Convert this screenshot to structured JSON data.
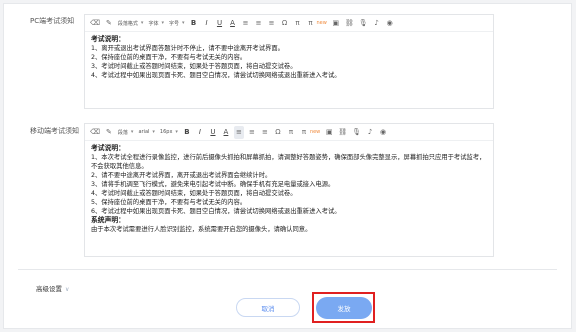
{
  "pc_section": {
    "label": "PC端考试须知",
    "toolbar": [
      "段落格式",
      "字体",
      "字号"
    ],
    "lines": [
      {
        "text": "考试说明：",
        "bold": true
      },
      {
        "text": "1、离开或退出考试界面答题计时不停止，请不要中途离开考试界面。"
      },
      {
        "text": "2、保持座位前的桌面干净，不要有与考试无关的内容。"
      },
      {
        "text": "3、考试时间截止或答题时间结束，如果处于答题页面，将自动提交试卷。"
      },
      {
        "text": "4、考试过程中如果出现页面卡死、题目空白情况，请尝试切换网络或退出重新进入考试。"
      }
    ]
  },
  "mobile_section": {
    "label": "移动端考试须知",
    "toolbar": [
      "段落",
      "arial",
      "16px"
    ],
    "lines": [
      {
        "text": "考试说明：",
        "bold": true
      },
      {
        "text": "1、本次考试全程进行录像监控，进行前后摄像头抓拍和屏幕抓拍，请调整好答题姿势，确保面部头像完整显示，屏幕抓拍只应用于考试监考，不会获取其他信息。"
      },
      {
        "text": "2、请不要中途离开考试界面，离开或退出考试界面会继续计时。"
      },
      {
        "text": "3、请将手机调至飞行模式，避免来电引起考试中断。确保手机有充足电量或接入电源。"
      },
      {
        "text": "4、考试时间截止或答题时间结束，如果处于答题页面，将自动提交试卷。"
      },
      {
        "text": "5、保持座位前的桌面干净，不要有与考试无关的内容。"
      },
      {
        "text": "6、考试过程中如果出现页面卡死、题目空白情况，请尝试切换网络或退出重新进入考试。"
      },
      {
        "text": "系统声明：",
        "bold": true
      },
      {
        "text": "由于本次考试需要进行人脸识别监控，系统需要开启您的摄像头，请确认同意。"
      }
    ]
  },
  "toolbar_icons": {
    "eraser": "⌫",
    "brush": "✎",
    "bold": "B",
    "italic": "I",
    "underline": "U",
    "font_color": "A",
    "align_left": "≡",
    "align_center": "≡",
    "align_right": "≡",
    "omega": "Ω",
    "pi": "π",
    "pi_new": "π",
    "new_badge": "new",
    "image": "▣",
    "link": "⛓",
    "mic": "🎙",
    "music": "♪",
    "camera": "◉"
  },
  "advanced": {
    "label": "高级设置",
    "chevron": "∨"
  },
  "buttons": {
    "cancel": "取消",
    "publish": "发放"
  },
  "colors": {
    "highlight": "#e02020",
    "primary": "#7aa9f2"
  }
}
